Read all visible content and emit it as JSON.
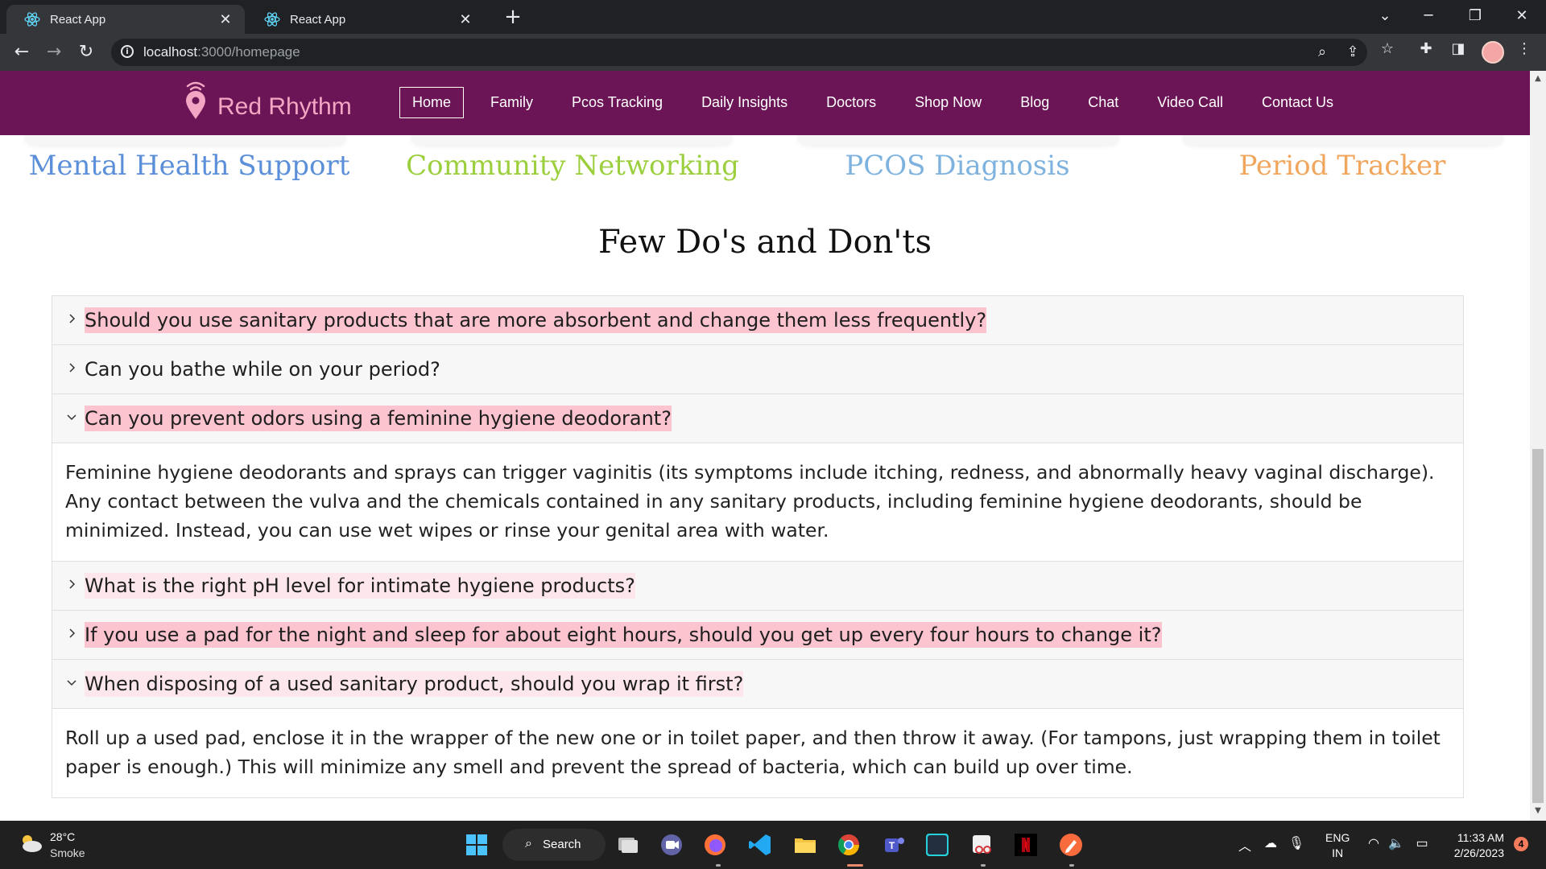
{
  "browser": {
    "tabs": [
      {
        "title": "React App",
        "active": true
      },
      {
        "title": "React App",
        "active": false
      }
    ],
    "new_tab_label": "+",
    "url_host": "localhost",
    "url_path": ":3000/homepage"
  },
  "site": {
    "brand": "Red Rhythm",
    "nav": [
      {
        "label": "Home",
        "active": true
      },
      {
        "label": "Family"
      },
      {
        "label": "Pcos Tracking"
      },
      {
        "label": "Daily Insights"
      },
      {
        "label": "Doctors"
      },
      {
        "label": "Shop Now"
      },
      {
        "label": "Blog"
      },
      {
        "label": "Chat"
      },
      {
        "label": "Video Call"
      },
      {
        "label": "Contact Us"
      }
    ],
    "services": [
      {
        "title": "Mental Health Support",
        "color": "#5b8fd9"
      },
      {
        "title": "Community Networking",
        "color": "#9ccf3d"
      },
      {
        "title": "PCOS Diagnosis",
        "color": "#7eb3df"
      },
      {
        "title": "Period Tracker",
        "color": "#f0a65c"
      }
    ],
    "section_heading": "Few Do's and Don'ts",
    "faq": [
      {
        "question": "Should you use sanitary products that are more absorbent and change them less frequently?",
        "expanded": false,
        "answer": ""
      },
      {
        "question": "Can you bathe while on your period?",
        "expanded": false,
        "answer": ""
      },
      {
        "question": "Can you prevent odors using a feminine hygiene deodorant?",
        "expanded": true,
        "answer": "Feminine hygiene deodorants and sprays can trigger vaginitis (its symptoms include itching, redness, and abnormally heavy vaginal discharge). Any contact between the vulva and the chemicals contained in any sanitary products, including feminine hygiene deodorants, should be minimized. Instead, you can use wet wipes or rinse your genital area with water."
      },
      {
        "question": "What is the right pH level for intimate hygiene products?",
        "expanded": false,
        "answer": ""
      },
      {
        "question": "If you use a pad for the night and sleep for about eight hours, should you get up every four hours to change it?",
        "expanded": false,
        "answer": ""
      },
      {
        "question": "When disposing of a used sanitary product, should you wrap it first?",
        "expanded": true,
        "answer": "Roll up a used pad, enclose it in the wrapper of the new one or in toilet paper, and then throw it away. (For tampons, just wrapping them in toilet paper is enough.) This will minimize any smell and prevent the spread of bacteria, which can build up over time."
      }
    ]
  },
  "taskbar": {
    "weather_temp": "28°C",
    "weather_desc": "Smoke",
    "search_label": "Search",
    "lang_line1": "ENG",
    "lang_line2": "IN",
    "time": "11:33 AM",
    "date": "2/26/2023",
    "notification_count": "4"
  },
  "colors": {
    "nav_bg": "#6c1556",
    "brand_pink": "#f2a6c3",
    "highlight": "#fbc4cf"
  }
}
